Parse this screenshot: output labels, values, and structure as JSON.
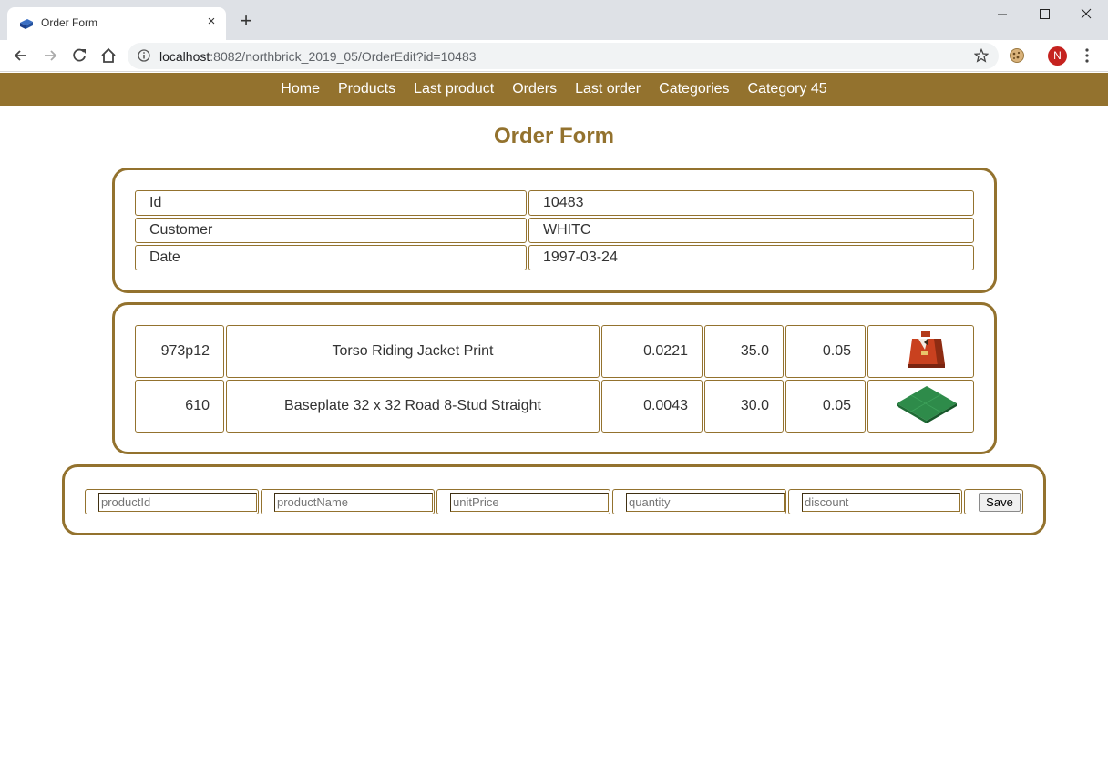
{
  "browser": {
    "tab_title": "Order Form",
    "tab_close_glyph": "×",
    "new_tab_glyph": "+",
    "url_host": "localhost",
    "url_rest": ":8082/northbrick_2019_05/OrderEdit?id=10483",
    "profile_initial": "N"
  },
  "nav": {
    "items": [
      "Home",
      "Products",
      "Last product",
      "Orders",
      "Last order",
      "Categories",
      "Category 45"
    ]
  },
  "page": {
    "title": "Order Form"
  },
  "order": {
    "fields": [
      {
        "label": "Id",
        "value": "10483"
      },
      {
        "label": "Customer",
        "value": "WHITC"
      },
      {
        "label": "Date",
        "value": "1997-03-24"
      }
    ]
  },
  "lines": [
    {
      "product_id": "973p12",
      "name": "Torso Riding Jacket Print",
      "unit_price": "0.0221",
      "quantity": "35.0",
      "discount": "0.05",
      "image": "torso-riding-jacket-image"
    },
    {
      "product_id": "610",
      "name": "Baseplate 32 x 32 Road 8-Stud Straight",
      "unit_price": "0.0043",
      "quantity": "30.0",
      "discount": "0.05",
      "image": "green-baseplate-image"
    }
  ],
  "add_form": {
    "placeholders": {
      "product_id": "productId",
      "product_name": "productName",
      "unit_price": "unitPrice",
      "quantity": "quantity",
      "discount": "discount"
    },
    "save_label": "Save"
  },
  "colors": {
    "accent": "#93722e",
    "torso": "#c9411f",
    "baseplate": "#2e8b4a"
  }
}
